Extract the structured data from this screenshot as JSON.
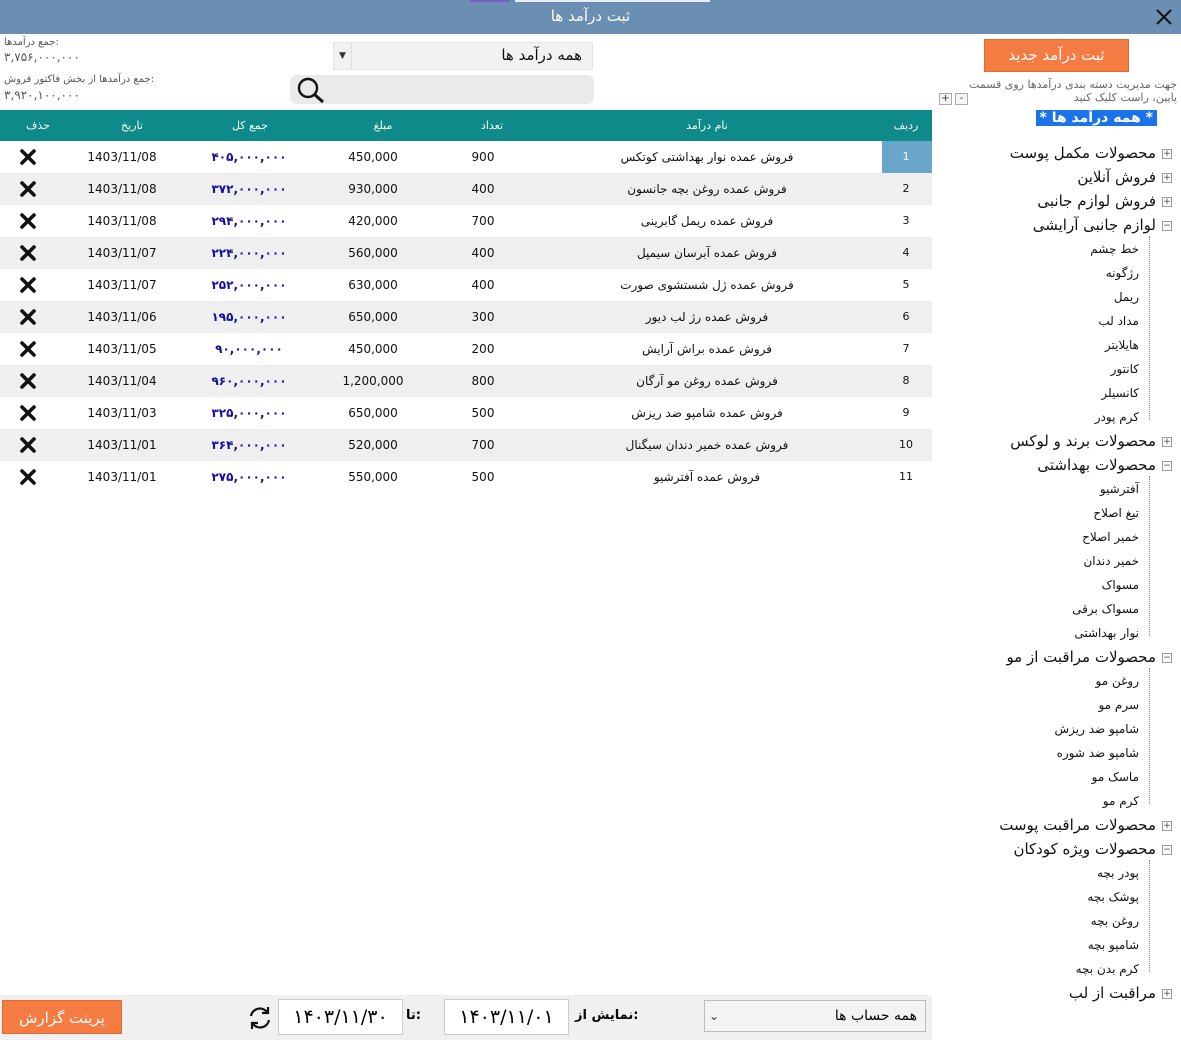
{
  "window": {
    "title": "ثبت درآمد ها"
  },
  "summary": {
    "total_income_label": "جمع درآمدها:",
    "total_income_value": "۳,۷۵۶,۰۰۰,۰۰۰",
    "invoice_income_label": "جمع درآمدها از بخش فاکتور فروش:",
    "invoice_income_value": "۳,۹۲۰,۱۰۰,۰۰۰"
  },
  "filter": {
    "selected": "همه درآمد ها"
  },
  "search": {
    "placeholder": ""
  },
  "toolbar": {
    "new_income_label": "ثبت درآمد جدید"
  },
  "tree_hint": "جهت مدیریت دسته بندی درآمدها روی قسمت پایین، راست کلیک کنید",
  "tree_buttons": {
    "collapse": "-",
    "expand": "+"
  },
  "table": {
    "columns": {
      "row": "ردیف",
      "name": "نام درآمد",
      "count": "تعداد",
      "price": "مبلغ",
      "total": "جمع کل",
      "date": "تاریخ",
      "delete": "حذف"
    },
    "rows": [
      {
        "row": "1",
        "name": "فروش عمده نوار بهداشتی کوتکس",
        "count": "900",
        "price": "450,000",
        "total": "۴۰۵,۰۰۰,۰۰۰",
        "date": "1403/11/08"
      },
      {
        "row": "2",
        "name": "فروش عمده روغن بچه جانسون",
        "count": "400",
        "price": "930,000",
        "total": "۳۷۲,۰۰۰,۰۰۰",
        "date": "1403/11/08"
      },
      {
        "row": "3",
        "name": "فروش عمده ریمل گابرینی",
        "count": "700",
        "price": "420,000",
        "total": "۲۹۴,۰۰۰,۰۰۰",
        "date": "1403/11/08"
      },
      {
        "row": "4",
        "name": "فروش عمده آبرسان سیمپل",
        "count": "400",
        "price": "560,000",
        "total": "۲۲۴,۰۰۰,۰۰۰",
        "date": "1403/11/07"
      },
      {
        "row": "5",
        "name": "فروش عمده ژل شستشوی صورت",
        "count": "400",
        "price": "630,000",
        "total": "۲۵۲,۰۰۰,۰۰۰",
        "date": "1403/11/07"
      },
      {
        "row": "6",
        "name": "فروش عمده رژ لب دیور",
        "count": "300",
        "price": "650,000",
        "total": "۱۹۵,۰۰۰,۰۰۰",
        "date": "1403/11/06"
      },
      {
        "row": "7",
        "name": "فروش عمده براش آرایش",
        "count": "200",
        "price": "450,000",
        "total": "۹۰,۰۰۰,۰۰۰",
        "date": "1403/11/05"
      },
      {
        "row": "8",
        "name": "فروش عمده روغن مو آرگان",
        "count": "800",
        "price": "1,200,000",
        "total": "۹۶۰,۰۰۰,۰۰۰",
        "date": "1403/11/04"
      },
      {
        "row": "9",
        "name": "فروش عمده شامپو ضد ریزش",
        "count": "500",
        "price": "650,000",
        "total": "۳۲۵,۰۰۰,۰۰۰",
        "date": "1403/11/03"
      },
      {
        "row": "10",
        "name": "فروش عمده خمیر دندان سیگنال",
        "count": "700",
        "price": "520,000",
        "total": "۳۶۴,۰۰۰,۰۰۰",
        "date": "1403/11/01"
      },
      {
        "row": "11",
        "name": "فروش عمده آفترشیو",
        "count": "500",
        "price": "550,000",
        "total": "۲۷۵,۰۰۰,۰۰۰",
        "date": "1403/11/01"
      }
    ]
  },
  "tree": {
    "root": "* همه درآمد ها *",
    "groups": [
      {
        "label": "محصولات مکمل پوست",
        "expanded": false,
        "children": []
      },
      {
        "label": "فروش آنلاین",
        "expanded": false,
        "children": []
      },
      {
        "label": "فروش لوازم جانبی",
        "expanded": false,
        "children": []
      },
      {
        "label": "لوازم جانبی آرایشی",
        "expanded": true,
        "children": [
          "خط چشم",
          "رژگونه",
          "ریمل",
          "مداد لب",
          "هایلایتر",
          "کانتور",
          "کانسیلر",
          "کرم پودر"
        ]
      },
      {
        "label": "محصولات برند و لوکس",
        "expanded": false,
        "children": []
      },
      {
        "label": "محصولات بهداشتی",
        "expanded": true,
        "children": [
          "آفترشیو",
          "تیغ اصلاح",
          "خمیر اصلاح",
          "خمیر دندان",
          "مسواک",
          "مسواک برقی",
          "نوار بهداشتی"
        ]
      },
      {
        "label": "محصولات مراقبت از مو",
        "expanded": true,
        "children": [
          "روغن مو",
          "سرم مو",
          "شامپو ضد ریزش",
          "شامپو ضد شوره",
          "ماسک مو",
          "کرم مو"
        ]
      },
      {
        "label": "محصولات مراقبت پوست",
        "expanded": false,
        "children": []
      },
      {
        "label": "محصولات ویژه کودکان",
        "expanded": true,
        "children": [
          "پودر بچه",
          "پوشک بچه",
          "روغن بچه",
          "شامپو بچه",
          "کرم بدن بچه"
        ]
      },
      {
        "label": "مراقبت از لب",
        "expanded": false,
        "children": []
      }
    ]
  },
  "bottom": {
    "print_label": "پرینت گزارش",
    "to_label": "تا:",
    "to_date": "۱۴۰۳/۱۱/۳۰",
    "from_label": "نمایش از:",
    "from_date": "۱۴۰۳/۱۱/۰۱",
    "account_selected": "همه حساب ها"
  }
}
